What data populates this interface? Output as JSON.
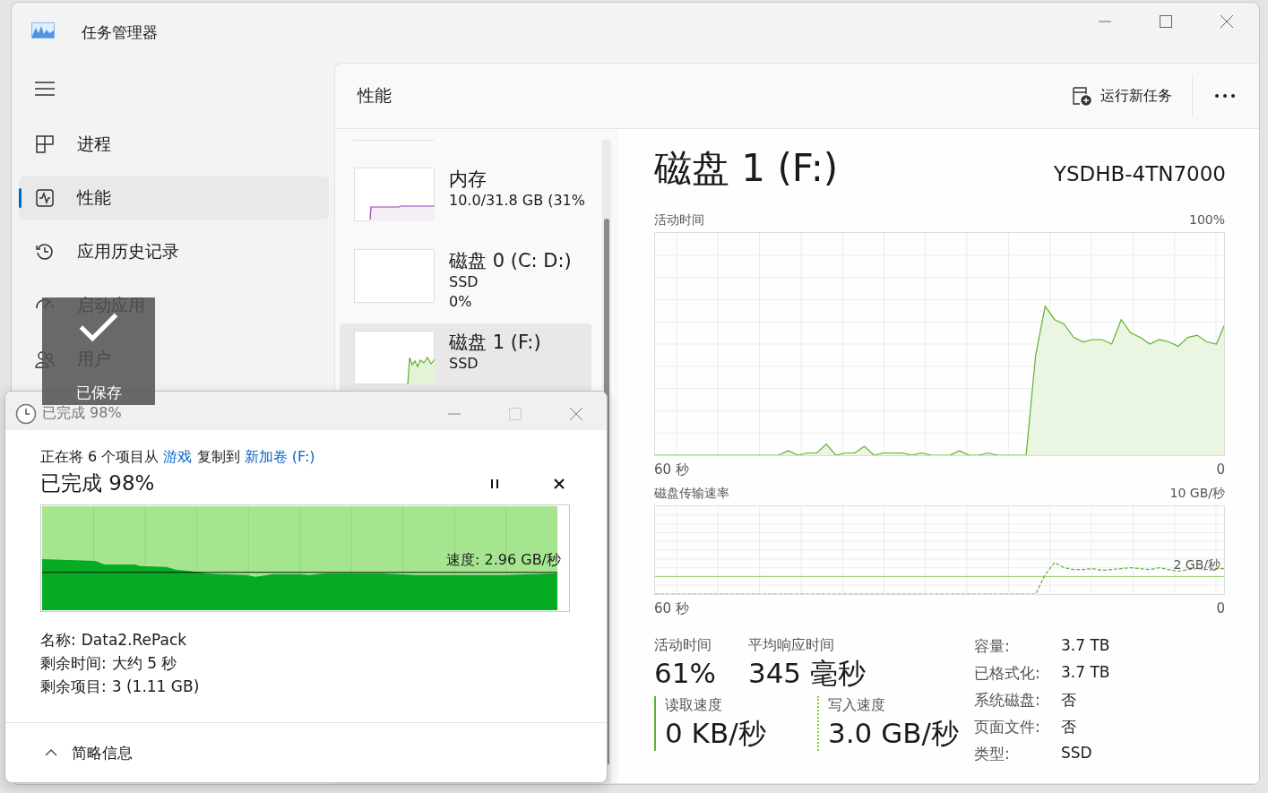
{
  "window": {
    "title": "任务管理器"
  },
  "sidebar": {
    "items": [
      {
        "label": "进程",
        "selected": false
      },
      {
        "label": "性能",
        "selected": true
      },
      {
        "label": "应用历史记录",
        "selected": false
      },
      {
        "label": "启动应用",
        "selected": false
      },
      {
        "label": "用户",
        "selected": false
      }
    ]
  },
  "header": {
    "title": "性能",
    "run_task": "运行新任务"
  },
  "devices": [
    {
      "kind": "memory",
      "name": "内存",
      "lines": [
        "10.0/31.8 GB (31%"
      ],
      "selected": false
    },
    {
      "kind": "disk",
      "name": "磁盘 0 (C: D:)",
      "lines": [
        "SSD",
        "0%"
      ],
      "selected": false
    },
    {
      "kind": "disk",
      "name": "磁盘 1 (F:)",
      "lines": [
        "SSD"
      ],
      "selected": true
    }
  ],
  "detail": {
    "title": "磁盘 1 (F:)",
    "model": "YSDHB-4TN7000",
    "charts": [
      {
        "kind": "area",
        "title": "活动时间",
        "max_label": "100%",
        "time_label": "60 秒",
        "min_label": "0"
      },
      {
        "kind": "line",
        "title": "磁盘传输速率",
        "max_label": "10 GB/秒",
        "time_label": "60 秒",
        "min_label": "0",
        "reference_label": "2 GB/秒"
      }
    ],
    "stats": [
      {
        "label": "活动时间",
        "value": "61%"
      },
      {
        "label": "平均响应时间",
        "value": "345 毫秒"
      }
    ],
    "speeds": [
      {
        "kind": "solid",
        "label": "读取速度",
        "value": "0 KB/秒"
      },
      {
        "kind": "dotted",
        "label": "写入速度",
        "value": "3.0 GB/秒"
      }
    ],
    "properties": [
      {
        "label": "容量:",
        "value": "3.7 TB"
      },
      {
        "label": "已格式化:",
        "value": "3.7 TB"
      },
      {
        "label": "系统磁盘:",
        "value": "否"
      },
      {
        "label": "页面文件:",
        "value": "否"
      },
      {
        "label": "类型:",
        "value": "SSD"
      }
    ]
  },
  "copy_dialog": {
    "title": "已完成 98%",
    "message": [
      {
        "kind": "text",
        "text": "正在将 6 个项目从 "
      },
      {
        "kind": "link",
        "text": "游戏"
      },
      {
        "kind": "text",
        "text": " 复制到 "
      },
      {
        "kind": "link",
        "text": "新加卷 (F:)"
      }
    ],
    "progress_title": "已完成 98%",
    "level": 0.98,
    "speed": "速度: 2.96 GB/秒",
    "details": [
      {
        "label": "名称:",
        "value": "Data2.RePack"
      },
      {
        "label": "剩余时间:",
        "value": "大约 5 秒"
      },
      {
        "label": "剩余项目:",
        "value": "3 (1.11 GB)"
      }
    ],
    "toggle": "简略信息",
    "expanded": true
  },
  "toast": {
    "label": "已保存"
  }
}
